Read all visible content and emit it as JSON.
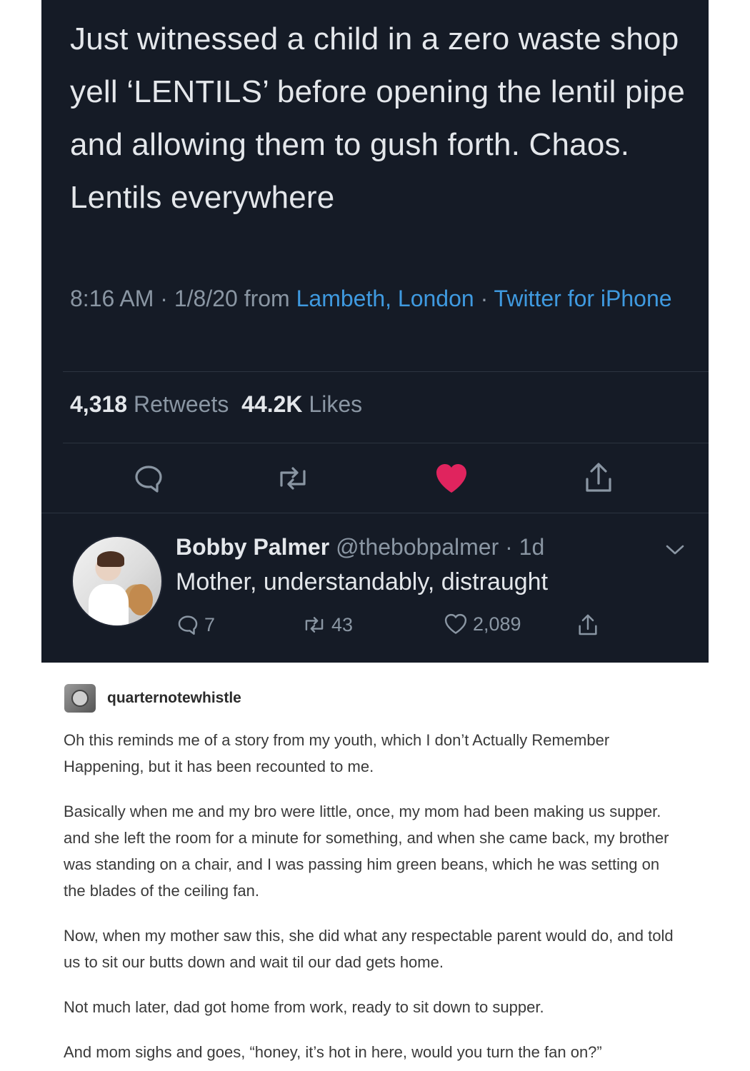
{
  "tweet": {
    "text": "Just witnessed a child in a zero waste shop yell ‘LENTILS’ before opening the lentil pipe and allowing them to gush forth. Chaos. Lentils everywhere",
    "time": "8:16 AM · 1/8/20 from ",
    "location": "Lambeth, London",
    "sep": " · ",
    "source": "Twitter for iPhone",
    "retweets_count": "4,318",
    "retweets_label": "Retweets",
    "likes_count": "44.2K",
    "likes_label": "Likes",
    "colors": {
      "background": "#151b26",
      "link": "#3f9ae0",
      "like": "#e0245e"
    }
  },
  "reply": {
    "name": "Bobby Palmer",
    "handle": "@thebobpalmer",
    "time": " · 1d",
    "text": "Mother, understandably, distraught",
    "replies": "7",
    "retweets": "43",
    "likes": "2,089"
  },
  "tumblr": {
    "username": "quarternotewhistle",
    "paragraphs": [
      "Oh this reminds me of a story from my youth, which I don’t Actually Remember Happening, but it has been recounted to me.",
      "Basically when me and my bro were little, once, my mom had been making us supper. and she left the room for a minute for something, and when she came back, my brother was standing on a chair, and I was passing him green beans, which he was setting on the blades of the ceiling fan.",
      "Now, when my mother saw this, she did what any respectable parent would do, and told us to sit our butts down and wait til our dad gets home.",
      "Not much later, dad got home from work, ready to sit down to supper.",
      "And mom sighs and goes, “honey, it’s hot in here, would you turn the fan on?”"
    ]
  }
}
